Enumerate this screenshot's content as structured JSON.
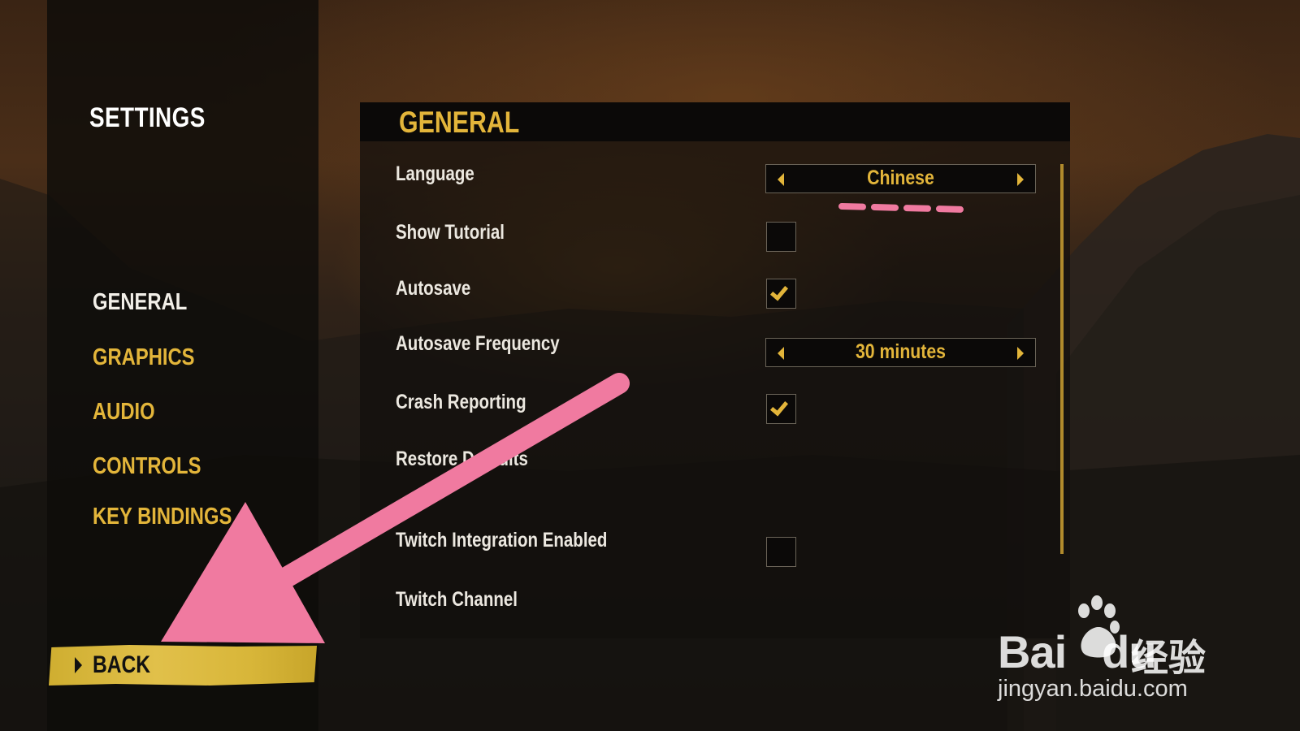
{
  "sidebar": {
    "title": "SETTINGS",
    "items": [
      {
        "label": "GENERAL",
        "active": true
      },
      {
        "label": "GRAPHICS",
        "active": false
      },
      {
        "label": "AUDIO",
        "active": false
      },
      {
        "label": "CONTROLS",
        "active": false
      },
      {
        "label": "KEY BINDINGS",
        "active": false
      }
    ],
    "back_label": "BACK"
  },
  "panel": {
    "title": "GENERAL",
    "rows": {
      "language": {
        "label": "Language",
        "value": "Chinese"
      },
      "show_tutorial": {
        "label": "Show Tutorial",
        "checked": false
      },
      "autosave": {
        "label": "Autosave",
        "checked": true
      },
      "autosave_frequency": {
        "label": "Autosave Frequency",
        "value": "30 minutes"
      },
      "crash_reporting": {
        "label": "Crash Reporting",
        "checked": true
      },
      "restore_defaults": {
        "label": "Restore Defaults"
      },
      "twitch_integration": {
        "label": "Twitch Integration Enabled",
        "checked": false
      },
      "twitch_channel": {
        "label": "Twitch Channel"
      }
    }
  },
  "watermark": {
    "brand": "Bai",
    "brand_du": "du",
    "jingyan": "经验",
    "url": "jingyan.baidu.com"
  },
  "colors": {
    "accent": "#e3b53a",
    "annotation": "#f07aa0",
    "back_button": "#d8b639"
  }
}
